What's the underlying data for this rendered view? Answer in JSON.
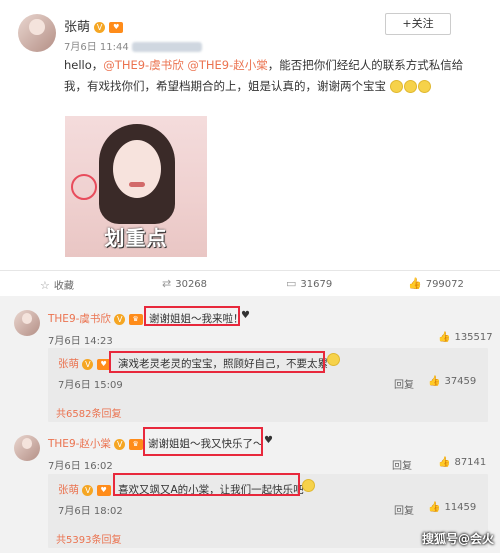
{
  "post": {
    "author": "张萌",
    "badge": "V",
    "level_icon": "heart-icon",
    "time": "7月6日 11:44",
    "follow_label": "+关注",
    "text_prefix": "hello，",
    "mention1": "@THE9-虞书欣",
    "mention2": "@THE9-赵小棠",
    "text_body": "，能否把你们经纪人的联系方式私信给我，有戏找你们，希望档期合的上，姐是认真的，谢谢两个宝宝",
    "image_caption": "划重点"
  },
  "actions": {
    "collect": "收藏",
    "repost": "30268",
    "comment": "31679",
    "like": "799072"
  },
  "comments": [
    {
      "name": "THE9-虞书欣",
      "text": "谢谢姐姐～我来啦！",
      "time": "7月6日 14:23",
      "likes": "135517",
      "reply": {
        "name": "张萌",
        "text": "演戏老灵老灵的宝宝，照顾好自己，不要太累",
        "time": "7月6日 15:09",
        "reply_label": "回复",
        "likes": "37459"
      },
      "more": "共6582条回复"
    },
    {
      "name": "THE9-赵小棠",
      "text": "谢谢姐姐～我又快乐了～",
      "time": "7月6日 16:02",
      "reply_label": "回复",
      "likes": "87141",
      "reply": {
        "name": "张萌",
        "text": "喜欢又飒又A的小棠，让我们一起快乐吧",
        "time": "7月6日 18:02",
        "reply_label": "回复",
        "likes": "11459"
      },
      "more": "共5393条回复"
    }
  ],
  "watermark": "搜狐号@会火",
  "colors": {
    "accent": "#eb7350",
    "highlight_box": "#e8283c"
  }
}
